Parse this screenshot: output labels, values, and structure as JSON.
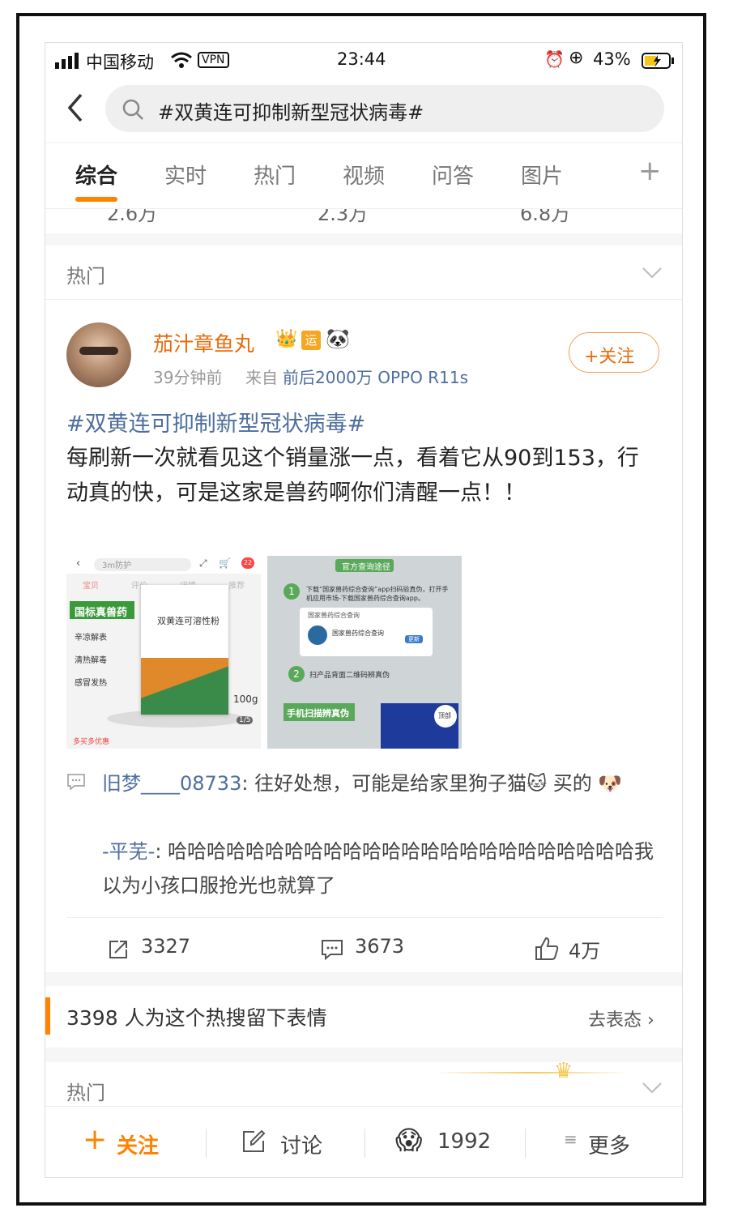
{
  "status_bar": {
    "carrier": "中国移动",
    "vpn": "VPN",
    "time": "23:44",
    "battery": "43%"
  },
  "search": {
    "query": "#双黄连可抑制新型冠状病毒#"
  },
  "tabs": [
    "综合",
    "实时",
    "热门",
    "视频",
    "问答",
    "图片"
  ],
  "prev_counts": [
    "2.6万",
    "2.3万",
    "6.8万"
  ],
  "section": {
    "title": "热门"
  },
  "post": {
    "author": "茄汁章鱼丸",
    "time": "39分钟前",
    "source_prefix": "来自",
    "source": "前后2000万 OPPO R11s",
    "follow_label": "+关注",
    "topic": "#双黄连可抑制新型冠状病毒#",
    "text": "每刷新一次就看见这个销量涨一点，看着它从90到153，行动真的快，可是这家是兽药啊你们清醒一点！！",
    "image1": {
      "search_text": "3m防护",
      "cart_badge": "22",
      "tabs": [
        "宝贝",
        "评价",
        "详情",
        "推荐"
      ],
      "banner": "国标真兽药",
      "features": [
        "辛凉解表",
        "清热解毒",
        "感冒发热"
      ],
      "product_name": "双黄连可溶性粉",
      "weight": "100g",
      "page": "1/5",
      "promo": "多买多优惠"
    },
    "image2": {
      "title": "官方查询途径",
      "step1": "下载“国家兽药综合查询”app扫码验真伪，打开手机应用市场-下载国家兽药综合查询app。",
      "app_search": "国家兽药综合查询",
      "app_name": "国家兽药综合查询",
      "update": "更新",
      "step2": "扫产品背面二维码辨真伪",
      "scan_label": "手机扫描辨真伪",
      "top_label": "顶部"
    },
    "comments": [
      {
        "user": "旧梦____08733",
        "text": ": 往好处想，可能是给家里狗子猫🐱 买的 🐶"
      },
      {
        "user": "-平芜-",
        "text": ": 哈哈哈哈哈哈哈哈哈哈哈哈哈哈哈哈哈哈哈哈哈哈哈哈我以为小孩口服抢光也就算了"
      }
    ],
    "actions": {
      "repost": "3327",
      "comment": "3673",
      "like": "4万"
    }
  },
  "emotion_bar": {
    "text": "3398 人为这个热搜留下表情",
    "link": "去表态 ›"
  },
  "section2": {
    "title": "热门"
  },
  "bottom_bar": {
    "follow": "关注",
    "discuss": "讨论",
    "emoji_count": "1992",
    "more": "更多"
  },
  "colors": {
    "accent": "#ff8200",
    "link": "#4d6e9f",
    "name": "#e86b0a"
  }
}
